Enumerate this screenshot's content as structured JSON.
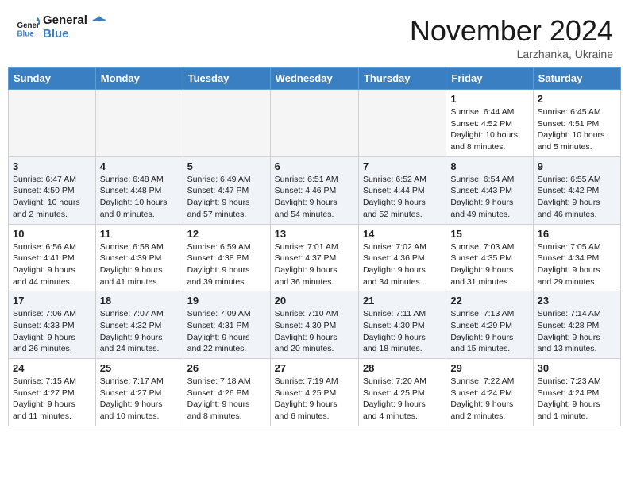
{
  "logo": {
    "line1": "General",
    "line2": "Blue"
  },
  "title": "November 2024",
  "location": "Larzhanka, Ukraine",
  "weekdays": [
    "Sunday",
    "Monday",
    "Tuesday",
    "Wednesday",
    "Thursday",
    "Friday",
    "Saturday"
  ],
  "weeks": [
    [
      {
        "day": "",
        "info": ""
      },
      {
        "day": "",
        "info": ""
      },
      {
        "day": "",
        "info": ""
      },
      {
        "day": "",
        "info": ""
      },
      {
        "day": "",
        "info": ""
      },
      {
        "day": "1",
        "info": "Sunrise: 6:44 AM\nSunset: 4:52 PM\nDaylight: 10 hours\nand 8 minutes."
      },
      {
        "day": "2",
        "info": "Sunrise: 6:45 AM\nSunset: 4:51 PM\nDaylight: 10 hours\nand 5 minutes."
      }
    ],
    [
      {
        "day": "3",
        "info": "Sunrise: 6:47 AM\nSunset: 4:50 PM\nDaylight: 10 hours\nand 2 minutes."
      },
      {
        "day": "4",
        "info": "Sunrise: 6:48 AM\nSunset: 4:48 PM\nDaylight: 10 hours\nand 0 minutes."
      },
      {
        "day": "5",
        "info": "Sunrise: 6:49 AM\nSunset: 4:47 PM\nDaylight: 9 hours\nand 57 minutes."
      },
      {
        "day": "6",
        "info": "Sunrise: 6:51 AM\nSunset: 4:46 PM\nDaylight: 9 hours\nand 54 minutes."
      },
      {
        "day": "7",
        "info": "Sunrise: 6:52 AM\nSunset: 4:44 PM\nDaylight: 9 hours\nand 52 minutes."
      },
      {
        "day": "8",
        "info": "Sunrise: 6:54 AM\nSunset: 4:43 PM\nDaylight: 9 hours\nand 49 minutes."
      },
      {
        "day": "9",
        "info": "Sunrise: 6:55 AM\nSunset: 4:42 PM\nDaylight: 9 hours\nand 46 minutes."
      }
    ],
    [
      {
        "day": "10",
        "info": "Sunrise: 6:56 AM\nSunset: 4:41 PM\nDaylight: 9 hours\nand 44 minutes."
      },
      {
        "day": "11",
        "info": "Sunrise: 6:58 AM\nSunset: 4:39 PM\nDaylight: 9 hours\nand 41 minutes."
      },
      {
        "day": "12",
        "info": "Sunrise: 6:59 AM\nSunset: 4:38 PM\nDaylight: 9 hours\nand 39 minutes."
      },
      {
        "day": "13",
        "info": "Sunrise: 7:01 AM\nSunset: 4:37 PM\nDaylight: 9 hours\nand 36 minutes."
      },
      {
        "day": "14",
        "info": "Sunrise: 7:02 AM\nSunset: 4:36 PM\nDaylight: 9 hours\nand 34 minutes."
      },
      {
        "day": "15",
        "info": "Sunrise: 7:03 AM\nSunset: 4:35 PM\nDaylight: 9 hours\nand 31 minutes."
      },
      {
        "day": "16",
        "info": "Sunrise: 7:05 AM\nSunset: 4:34 PM\nDaylight: 9 hours\nand 29 minutes."
      }
    ],
    [
      {
        "day": "17",
        "info": "Sunrise: 7:06 AM\nSunset: 4:33 PM\nDaylight: 9 hours\nand 26 minutes."
      },
      {
        "day": "18",
        "info": "Sunrise: 7:07 AM\nSunset: 4:32 PM\nDaylight: 9 hours\nand 24 minutes."
      },
      {
        "day": "19",
        "info": "Sunrise: 7:09 AM\nSunset: 4:31 PM\nDaylight: 9 hours\nand 22 minutes."
      },
      {
        "day": "20",
        "info": "Sunrise: 7:10 AM\nSunset: 4:30 PM\nDaylight: 9 hours\nand 20 minutes."
      },
      {
        "day": "21",
        "info": "Sunrise: 7:11 AM\nSunset: 4:30 PM\nDaylight: 9 hours\nand 18 minutes."
      },
      {
        "day": "22",
        "info": "Sunrise: 7:13 AM\nSunset: 4:29 PM\nDaylight: 9 hours\nand 15 minutes."
      },
      {
        "day": "23",
        "info": "Sunrise: 7:14 AM\nSunset: 4:28 PM\nDaylight: 9 hours\nand 13 minutes."
      }
    ],
    [
      {
        "day": "24",
        "info": "Sunrise: 7:15 AM\nSunset: 4:27 PM\nDaylight: 9 hours\nand 11 minutes."
      },
      {
        "day": "25",
        "info": "Sunrise: 7:17 AM\nSunset: 4:27 PM\nDaylight: 9 hours\nand 10 minutes."
      },
      {
        "day": "26",
        "info": "Sunrise: 7:18 AM\nSunset: 4:26 PM\nDaylight: 9 hours\nand 8 minutes."
      },
      {
        "day": "27",
        "info": "Sunrise: 7:19 AM\nSunset: 4:25 PM\nDaylight: 9 hours\nand 6 minutes."
      },
      {
        "day": "28",
        "info": "Sunrise: 7:20 AM\nSunset: 4:25 PM\nDaylight: 9 hours\nand 4 minutes."
      },
      {
        "day": "29",
        "info": "Sunrise: 7:22 AM\nSunset: 4:24 PM\nDaylight: 9 hours\nand 2 minutes."
      },
      {
        "day": "30",
        "info": "Sunrise: 7:23 AM\nSunset: 4:24 PM\nDaylight: 9 hours\nand 1 minute."
      }
    ]
  ]
}
